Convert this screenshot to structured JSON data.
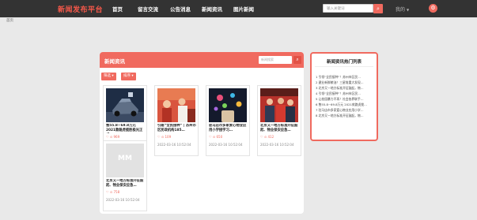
{
  "header": {
    "brand": "新闻发布平台",
    "nav": [
      "首页",
      "留言交流",
      "公告消息",
      "新闻资讯",
      "图片新闻"
    ],
    "search_placeholder": "输入关键词",
    "user_label": "我的"
  },
  "breadcrumb": "首页",
  "main": {
    "title": "新闻资讯",
    "search_placeholder": "新闻搜索",
    "filters": [
      "筛选",
      "排序"
    ],
    "cards": [
      {
        "title": "售55.8~69.8万元 2021款路虎揽胜极光正式…",
        "views": "969",
        "date": "2022-03-16 10:52:04"
      },
      {
        "title": "引路“全民接种” | 苏州市区民政机构185…",
        "views": "109",
        "date": "2022-03-16 10:52:04"
      },
      {
        "title": "驻马店市多家爱心物业应用小学接学习…",
        "views": "650",
        "date": "2022-03-16 10:52:04"
      },
      {
        "title": "北京又一地方标准开征鼓起、物业保安应急…",
        "views": "412",
        "date": "2022-03-16 10:52:04"
      },
      {
        "title": "北京又一地方标准开征鼓起、物业保安应急…",
        "views": "758",
        "date": "2022-03-16 10:52:04"
      }
    ],
    "placeholder_image_text": "MM"
  },
  "sidebar": {
    "title": "新闻资讯热门列表",
    "items": [
      "1  引领“全民接种”！苏州市区民…",
      "2  建业新鲜粮油！三星堆重大发现…",
      "3  北京又一地方标准开征鼓起，物…",
      "4  引领“全民接种”！苏州市区民…",
      "5  让校园暴力不再！社会各界联手…",
      "6  售55.8~69.8万元 2021款路虎揽…",
      "7  驻马店市多家爱心物业应用小学…",
      "8  北京又一地方标准开征鼓起，物…"
    ]
  },
  "colors": {
    "accent": "#f06a5f",
    "navbar": "#333333",
    "page_bg": "#e9e9e9"
  }
}
